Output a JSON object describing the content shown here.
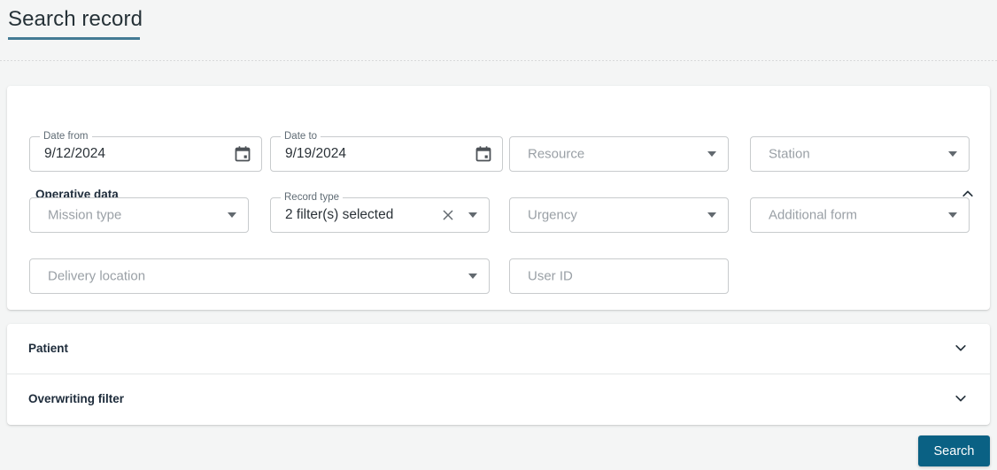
{
  "page": {
    "title": "Search record"
  },
  "colors": {
    "title_underline": "#437a94",
    "primary_button": "#0a6184",
    "card_background": "#ffffff",
    "page_background": "#f4f5f5"
  },
  "operative_panel": {
    "title": "Operative data",
    "expanded": true,
    "collapse_icon": "chevron-up-icon",
    "fields": {
      "date_from": {
        "label": "Date from",
        "value": "9/12/2024",
        "icon": "calendar-icon"
      },
      "date_to": {
        "label": "Date to",
        "value": "9/19/2024",
        "icon": "calendar-icon"
      },
      "resource": {
        "placeholder": "Resource",
        "value": "",
        "icon": "chevron-down-icon"
      },
      "station": {
        "placeholder": "Station",
        "value": "",
        "icon": "chevron-down-icon"
      },
      "mission_type": {
        "placeholder": "Mission type",
        "value": "",
        "icon": "chevron-down-icon"
      },
      "record_type": {
        "label": "Record type",
        "value": "2 filter(s) selected",
        "clear_icon": "close-icon",
        "icon": "chevron-down-icon"
      },
      "urgency": {
        "placeholder": "Urgency",
        "value": "",
        "icon": "chevron-down-icon"
      },
      "additional_form": {
        "placeholder": "Additional form",
        "value": "",
        "icon": "chevron-down-icon"
      },
      "delivery_location": {
        "placeholder": "Delivery location",
        "value": "",
        "icon": "chevron-down-icon"
      },
      "user_id": {
        "placeholder": "User ID",
        "value": ""
      }
    }
  },
  "sections": [
    {
      "title": "Patient",
      "expanded": false,
      "expand_icon": "chevron-down-icon"
    },
    {
      "title": "Overwriting filter",
      "expanded": false,
      "expand_icon": "chevron-down-icon"
    }
  ],
  "actions": {
    "search_label": "Search"
  }
}
